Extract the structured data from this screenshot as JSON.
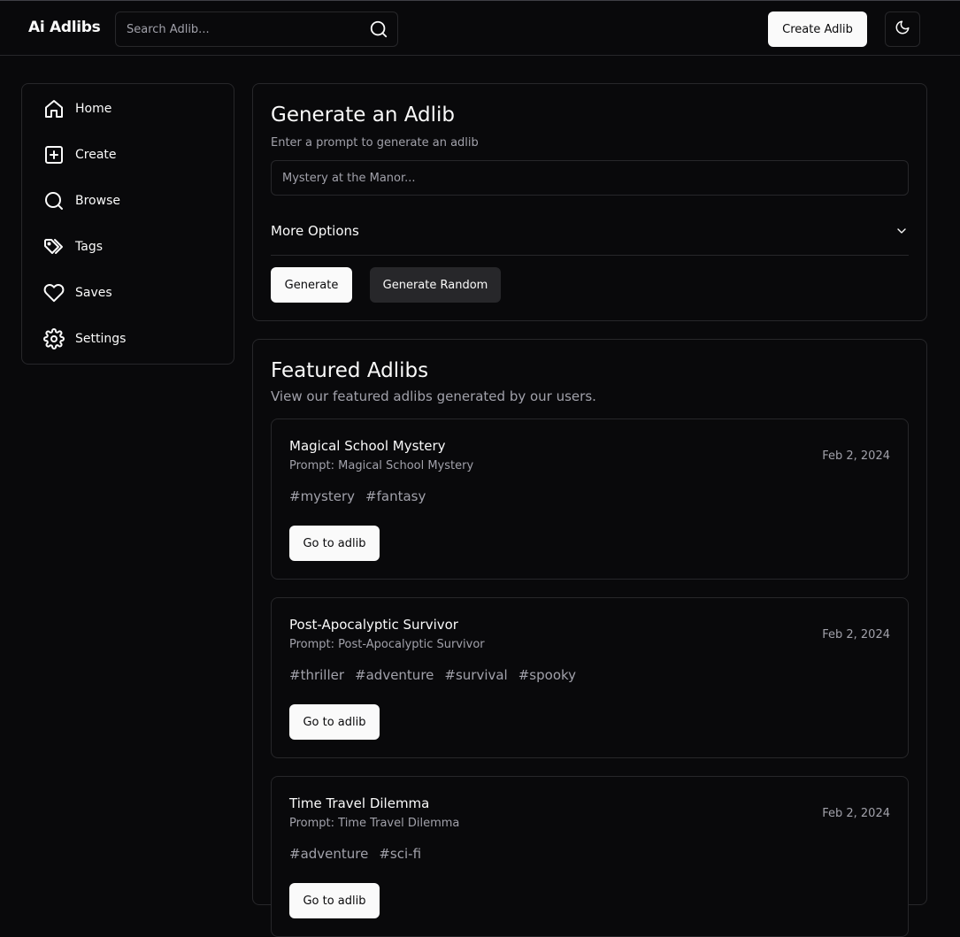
{
  "header": {
    "logo": "Ai Adlibs",
    "search_placeholder": "Search Adlib...",
    "create_label": "Create Adlib"
  },
  "sidebar": {
    "items": [
      {
        "label": "Home",
        "icon": "home-icon"
      },
      {
        "label": "Create",
        "icon": "plus-square-icon"
      },
      {
        "label": "Browse",
        "icon": "search-icon"
      },
      {
        "label": "Tags",
        "icon": "tags-icon"
      },
      {
        "label": "Saves",
        "icon": "heart-icon"
      },
      {
        "label": "Settings",
        "icon": "gear-icon"
      }
    ]
  },
  "generate": {
    "title": "Generate an Adlib",
    "subtitle": "Enter a prompt to generate an adlib",
    "placeholder": "Mystery at the Manor...",
    "more_options": "More Options",
    "generate_label": "Generate",
    "random_label": "Generate Random"
  },
  "featured": {
    "title": "Featured Adlibs",
    "subtitle": "View our featured adlibs generated by our users.",
    "items": [
      {
        "title": "Magical School Mystery",
        "prompt": "Prompt: Magical School Mystery",
        "date": "Feb 2, 2024",
        "tags": [
          "#mystery",
          "#fantasy"
        ],
        "button": "Go to adlib"
      },
      {
        "title": "Post-Apocalyptic Survivor",
        "prompt": "Prompt: Post-Apocalyptic Survivor",
        "date": "Feb 2, 2024",
        "tags": [
          "#thriller",
          "#adventure",
          "#survival",
          "#spooky"
        ],
        "button": "Go to adlib"
      },
      {
        "title": "Time Travel Dilemma",
        "prompt": "Prompt: Time Travel Dilemma",
        "date": "Feb 2, 2024",
        "tags": [
          "#adventure",
          "#sci-fi"
        ],
        "button": "Go to adlib"
      }
    ]
  },
  "colors": {
    "background": "#09090b",
    "border": "#27272a",
    "muted_text": "#a1a1aa",
    "primary_button": "#fafafa",
    "secondary_button": "#27272a"
  }
}
